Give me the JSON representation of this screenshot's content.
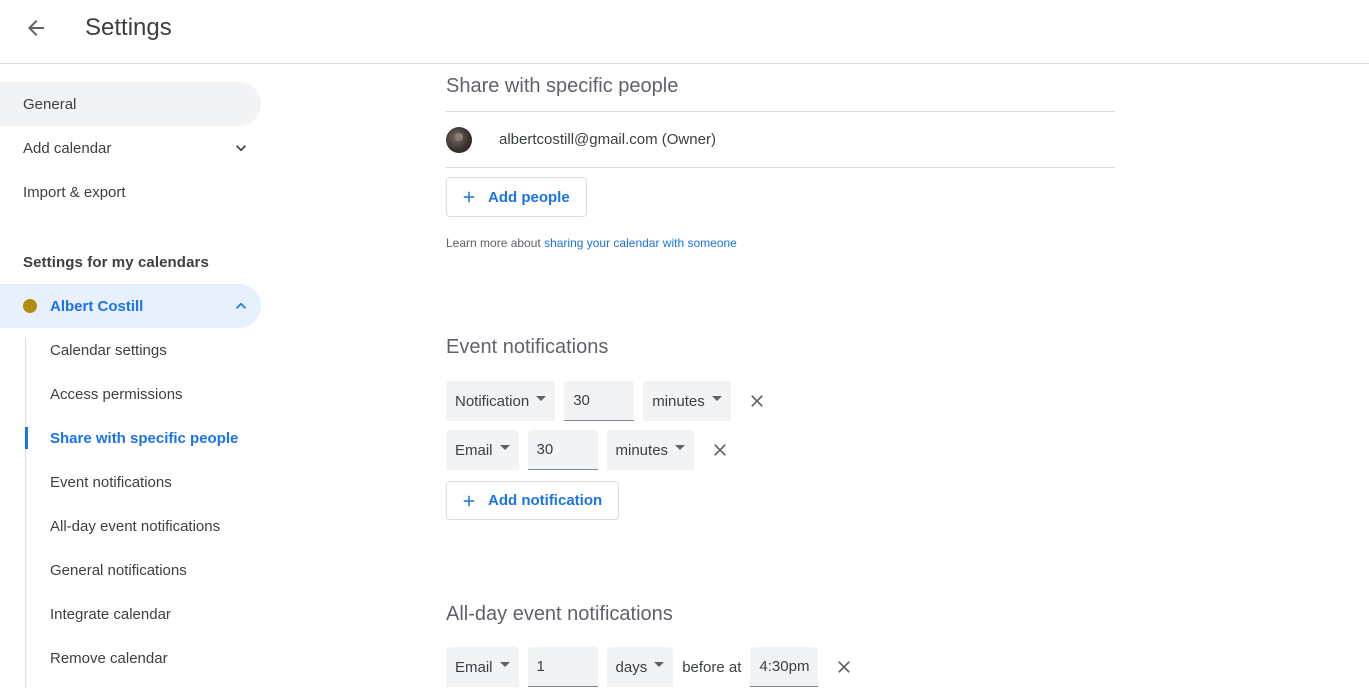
{
  "header": {
    "title": "Settings",
    "back_icon": "arrow-back-icon"
  },
  "sidebar": {
    "general": "General",
    "add_calendar": "Add calendar",
    "import_export": "Import & export",
    "my_calendars_heading": "Settings for my calendars",
    "calendar": {
      "name": "Albert Costill",
      "color": "#b08d0b"
    },
    "sub_items": [
      "Calendar settings",
      "Access permissions",
      "Share with specific people",
      "Event notifications",
      "All-day event notifications",
      "General notifications",
      "Integrate calendar",
      "Remove calendar"
    ]
  },
  "share": {
    "title": "Share with specific people",
    "person": "albertcostill@gmail.com (Owner)",
    "add_people": "Add people",
    "learn_prefix": "Learn more about ",
    "learn_link": "sharing your calendar with someone"
  },
  "event_notifications": {
    "title": "Event notifications",
    "rows": [
      {
        "type": "Notification",
        "value": "30",
        "unit": "minutes"
      },
      {
        "type": "Email",
        "value": "30",
        "unit": "minutes"
      }
    ],
    "add_label": "Add notification"
  },
  "allday_notifications": {
    "title": "All-day event notifications",
    "row": {
      "type": "Email",
      "value": "1",
      "unit": "days",
      "before_at": "before at",
      "time": "4:30pm"
    }
  },
  "colors": {
    "accent": "#1a73e8",
    "active_bg": "#e8f0fe",
    "hover_bg": "#f1f3f4"
  }
}
